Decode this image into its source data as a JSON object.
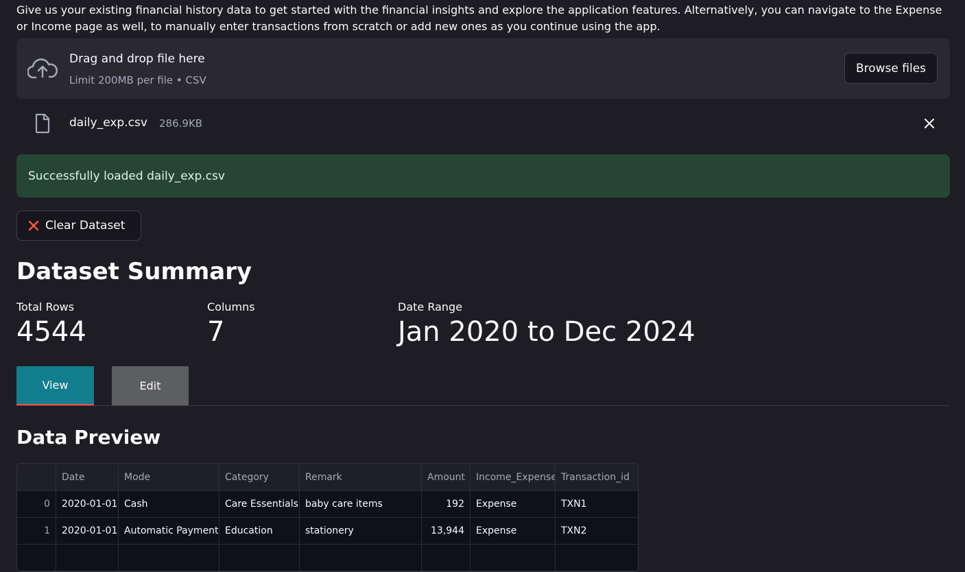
{
  "intro": "Give us your existing financial history data to get started with the financial insights and explore the application features. Alternatively, you can navigate to the Expense or Income page as well, to manually enter transactions from scratch or add new ones as you continue using the app.",
  "uploader": {
    "title": "Drag and drop file here",
    "subtitle": "Limit 200MB per file • CSV",
    "browse_label": "Browse files",
    "file_name": "daily_exp.csv",
    "file_size": "286.9KB"
  },
  "success_message": "Successfully loaded daily_exp.csv",
  "clear_label": "Clear Dataset",
  "summary": {
    "title": "Dataset Summary",
    "metrics": [
      {
        "label": "Total Rows",
        "value": "4544"
      },
      {
        "label": "Columns",
        "value": "7"
      },
      {
        "label": "Date Range",
        "value": "Jan 2020 to Dec 2024"
      }
    ]
  },
  "tabs": [
    {
      "label": "View",
      "active": true
    },
    {
      "label": "Edit",
      "active": false
    }
  ],
  "preview": {
    "title": "Data Preview",
    "columns": [
      "",
      "Date",
      "Mode",
      "Category",
      "Remark",
      "Amount",
      "Income_Expense",
      "Transaction_id"
    ],
    "rows": [
      [
        "0",
        "2020-01-01",
        "Cash",
        "Care Essentials",
        "baby care items",
        "192",
        "Expense",
        "TXN1"
      ],
      [
        "1",
        "2020-01-01",
        "Automatic Payment",
        "Education",
        "stationery",
        "13,944",
        "Expense",
        "TXN2"
      ]
    ]
  },
  "colors": {
    "background": "#1e1d24",
    "success_bg": "#274535",
    "tab_active": "#117e8e",
    "tab_inactive": "#5c5e61",
    "accent_red": "#ff4b4b"
  },
  "icons": {
    "upload": "cloud-upload-icon",
    "file": "file-icon",
    "close": "close-icon",
    "clear": "x-icon"
  }
}
